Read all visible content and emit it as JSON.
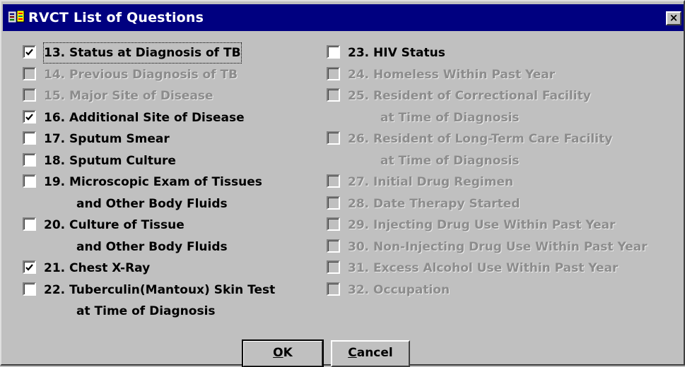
{
  "window": {
    "title": "RVCT List of Questions",
    "close_symbol": "×"
  },
  "left_column": [
    {
      "label": "13. Status at Diagnosis of TB",
      "checked": true,
      "enabled": true
    },
    {
      "label": "14. Previous Diagnosis of TB",
      "checked": false,
      "enabled": false
    },
    {
      "label": "15. Major Site of Disease",
      "checked": false,
      "enabled": false
    },
    {
      "label": "16. Additional Site of Disease",
      "checked": true,
      "enabled": true
    },
    {
      "label": "17. Sputum Smear",
      "checked": false,
      "enabled": true
    },
    {
      "label": "18. Sputum Culture",
      "checked": false,
      "enabled": true
    },
    {
      "label": "19. Microscopic Exam of Tissues",
      "continuation": "and Other Body Fluids",
      "checked": false,
      "enabled": true
    },
    {
      "label": "20. Culture of Tissue",
      "continuation": "and Other Body Fluids",
      "checked": false,
      "enabled": true
    },
    {
      "label": "21. Chest X-Ray",
      "checked": true,
      "enabled": true
    },
    {
      "label": "22. Tuberculin(Mantoux) Skin Test",
      "continuation": "at Time of Diagnosis",
      "checked": false,
      "enabled": true
    }
  ],
  "right_column": [
    {
      "label": "23. HIV Status",
      "checked": false,
      "enabled": true
    },
    {
      "label": "24. Homeless Within Past Year",
      "checked": false,
      "enabled": false
    },
    {
      "label": "25. Resident of Correctional Facility",
      "continuation": "at Time of Diagnosis",
      "checked": false,
      "enabled": false
    },
    {
      "label": "26. Resident of Long-Term Care Facility",
      "continuation": "at Time of Diagnosis",
      "checked": false,
      "enabled": false
    },
    {
      "label": "27. Initial Drug Regimen",
      "checked": false,
      "enabled": false
    },
    {
      "label": "28. Date Therapy Started",
      "checked": false,
      "enabled": false
    },
    {
      "label": "29. Injecting Drug Use Within Past Year",
      "checked": false,
      "enabled": false
    },
    {
      "label": "30. Non-Injecting Drug Use Within Past Year",
      "checked": false,
      "enabled": false
    },
    {
      "label": "31. Excess Alcohol Use Within Past Year",
      "checked": false,
      "enabled": false
    },
    {
      "label": "32. Occupation",
      "checked": false,
      "enabled": false
    }
  ],
  "buttons": {
    "ok_mnemonic": "O",
    "ok_rest": "K",
    "cancel_mnemonic": "C",
    "cancel_rest": "ancel"
  },
  "colors": {
    "titlebar": "#000080",
    "face": "#c0c0c0",
    "disabled_text": "#8c8c8c"
  }
}
